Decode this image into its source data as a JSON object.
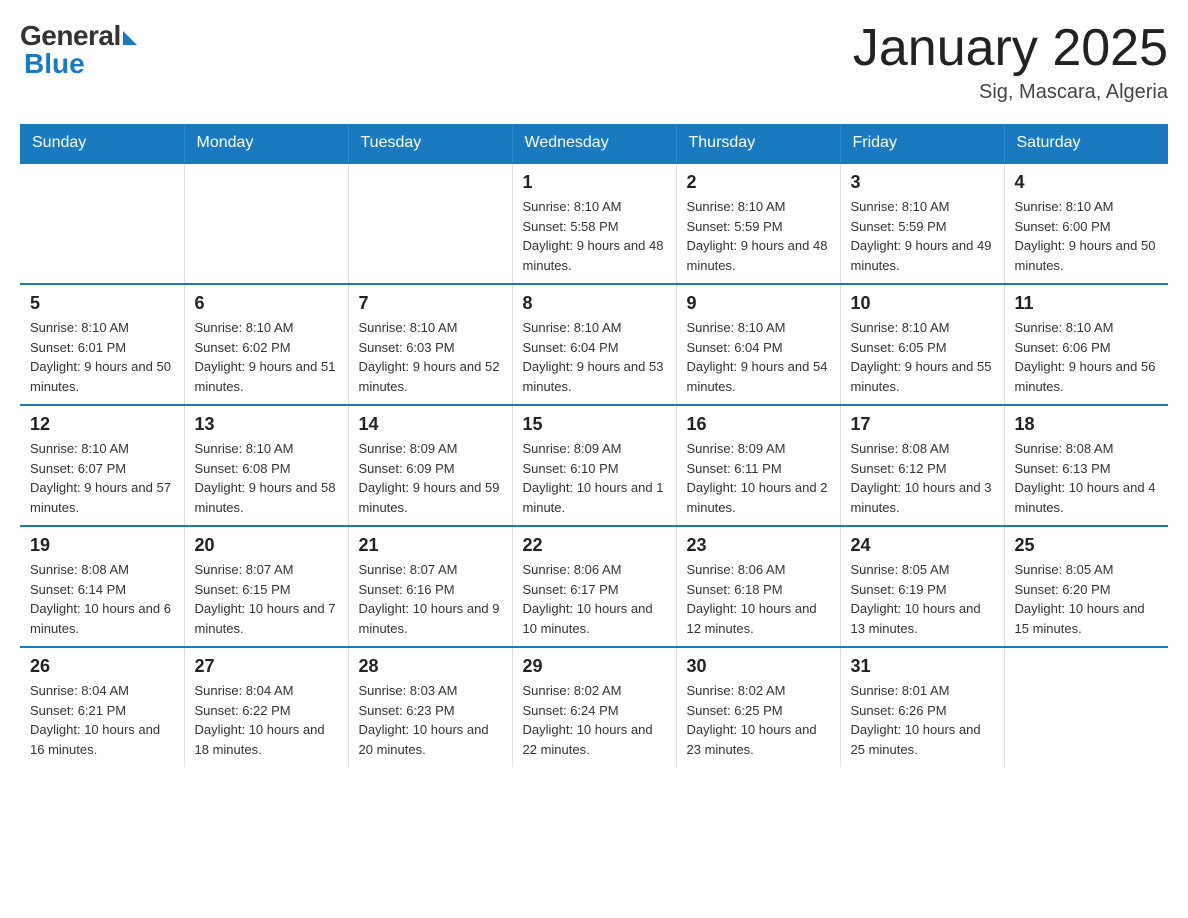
{
  "logo": {
    "general": "General",
    "blue": "Blue"
  },
  "title": "January 2025",
  "subtitle": "Sig, Mascara, Algeria",
  "days_of_week": [
    "Sunday",
    "Monday",
    "Tuesday",
    "Wednesday",
    "Thursday",
    "Friday",
    "Saturday"
  ],
  "weeks": [
    [
      {
        "day": "",
        "info": ""
      },
      {
        "day": "",
        "info": ""
      },
      {
        "day": "",
        "info": ""
      },
      {
        "day": "1",
        "info": "Sunrise: 8:10 AM\nSunset: 5:58 PM\nDaylight: 9 hours and 48 minutes."
      },
      {
        "day": "2",
        "info": "Sunrise: 8:10 AM\nSunset: 5:59 PM\nDaylight: 9 hours and 48 minutes."
      },
      {
        "day": "3",
        "info": "Sunrise: 8:10 AM\nSunset: 5:59 PM\nDaylight: 9 hours and 49 minutes."
      },
      {
        "day": "4",
        "info": "Sunrise: 8:10 AM\nSunset: 6:00 PM\nDaylight: 9 hours and 50 minutes."
      }
    ],
    [
      {
        "day": "5",
        "info": "Sunrise: 8:10 AM\nSunset: 6:01 PM\nDaylight: 9 hours and 50 minutes."
      },
      {
        "day": "6",
        "info": "Sunrise: 8:10 AM\nSunset: 6:02 PM\nDaylight: 9 hours and 51 minutes."
      },
      {
        "day": "7",
        "info": "Sunrise: 8:10 AM\nSunset: 6:03 PM\nDaylight: 9 hours and 52 minutes."
      },
      {
        "day": "8",
        "info": "Sunrise: 8:10 AM\nSunset: 6:04 PM\nDaylight: 9 hours and 53 minutes."
      },
      {
        "day": "9",
        "info": "Sunrise: 8:10 AM\nSunset: 6:04 PM\nDaylight: 9 hours and 54 minutes."
      },
      {
        "day": "10",
        "info": "Sunrise: 8:10 AM\nSunset: 6:05 PM\nDaylight: 9 hours and 55 minutes."
      },
      {
        "day": "11",
        "info": "Sunrise: 8:10 AM\nSunset: 6:06 PM\nDaylight: 9 hours and 56 minutes."
      }
    ],
    [
      {
        "day": "12",
        "info": "Sunrise: 8:10 AM\nSunset: 6:07 PM\nDaylight: 9 hours and 57 minutes."
      },
      {
        "day": "13",
        "info": "Sunrise: 8:10 AM\nSunset: 6:08 PM\nDaylight: 9 hours and 58 minutes."
      },
      {
        "day": "14",
        "info": "Sunrise: 8:09 AM\nSunset: 6:09 PM\nDaylight: 9 hours and 59 minutes."
      },
      {
        "day": "15",
        "info": "Sunrise: 8:09 AM\nSunset: 6:10 PM\nDaylight: 10 hours and 1 minute."
      },
      {
        "day": "16",
        "info": "Sunrise: 8:09 AM\nSunset: 6:11 PM\nDaylight: 10 hours and 2 minutes."
      },
      {
        "day": "17",
        "info": "Sunrise: 8:08 AM\nSunset: 6:12 PM\nDaylight: 10 hours and 3 minutes."
      },
      {
        "day": "18",
        "info": "Sunrise: 8:08 AM\nSunset: 6:13 PM\nDaylight: 10 hours and 4 minutes."
      }
    ],
    [
      {
        "day": "19",
        "info": "Sunrise: 8:08 AM\nSunset: 6:14 PM\nDaylight: 10 hours and 6 minutes."
      },
      {
        "day": "20",
        "info": "Sunrise: 8:07 AM\nSunset: 6:15 PM\nDaylight: 10 hours and 7 minutes."
      },
      {
        "day": "21",
        "info": "Sunrise: 8:07 AM\nSunset: 6:16 PM\nDaylight: 10 hours and 9 minutes."
      },
      {
        "day": "22",
        "info": "Sunrise: 8:06 AM\nSunset: 6:17 PM\nDaylight: 10 hours and 10 minutes."
      },
      {
        "day": "23",
        "info": "Sunrise: 8:06 AM\nSunset: 6:18 PM\nDaylight: 10 hours and 12 minutes."
      },
      {
        "day": "24",
        "info": "Sunrise: 8:05 AM\nSunset: 6:19 PM\nDaylight: 10 hours and 13 minutes."
      },
      {
        "day": "25",
        "info": "Sunrise: 8:05 AM\nSunset: 6:20 PM\nDaylight: 10 hours and 15 minutes."
      }
    ],
    [
      {
        "day": "26",
        "info": "Sunrise: 8:04 AM\nSunset: 6:21 PM\nDaylight: 10 hours and 16 minutes."
      },
      {
        "day": "27",
        "info": "Sunrise: 8:04 AM\nSunset: 6:22 PM\nDaylight: 10 hours and 18 minutes."
      },
      {
        "day": "28",
        "info": "Sunrise: 8:03 AM\nSunset: 6:23 PM\nDaylight: 10 hours and 20 minutes."
      },
      {
        "day": "29",
        "info": "Sunrise: 8:02 AM\nSunset: 6:24 PM\nDaylight: 10 hours and 22 minutes."
      },
      {
        "day": "30",
        "info": "Sunrise: 8:02 AM\nSunset: 6:25 PM\nDaylight: 10 hours and 23 minutes."
      },
      {
        "day": "31",
        "info": "Sunrise: 8:01 AM\nSunset: 6:26 PM\nDaylight: 10 hours and 25 minutes."
      },
      {
        "day": "",
        "info": ""
      }
    ]
  ]
}
